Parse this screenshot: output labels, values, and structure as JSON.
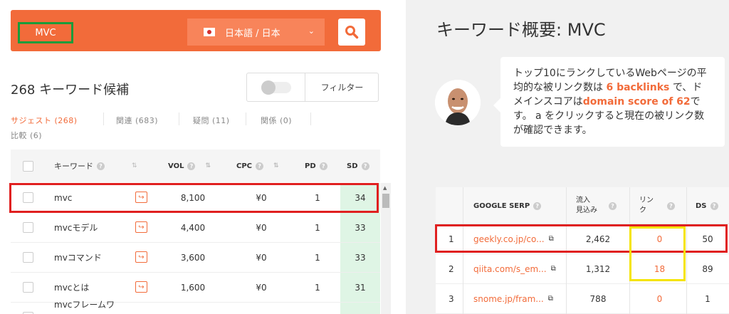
{
  "search": {
    "keyword": "MVC",
    "language": "日本語 / 日本"
  },
  "left": {
    "candidates_label": "268 キーワード候補",
    "filter_label": "フィルター",
    "tabs": [
      {
        "label": "サジェスト (268)",
        "active": true
      },
      {
        "label": "関連 (683)",
        "active": false
      },
      {
        "label": "疑問 (11)",
        "active": false
      },
      {
        "label": "関係 (0)",
        "active": false
      },
      {
        "label": "比較 (6)",
        "active": false
      }
    ],
    "table": {
      "headers": {
        "keyword": "キーワード",
        "vol": "VOL",
        "cpc": "CPC",
        "pd": "PD",
        "sd": "SD"
      },
      "rows": [
        {
          "keyword": "mvc",
          "vol": "8,100",
          "cpc": "¥0",
          "pd": "1",
          "sd": "34"
        },
        {
          "keyword": "mvcモデル",
          "vol": "4,400",
          "cpc": "¥0",
          "pd": "1",
          "sd": "33"
        },
        {
          "keyword": "mvコマンド",
          "vol": "3,600",
          "cpc": "¥0",
          "pd": "1",
          "sd": "33"
        },
        {
          "keyword": "mvcとは",
          "vol": "1,600",
          "cpc": "¥0",
          "pd": "1",
          "sd": "31"
        },
        {
          "keyword": "mvcフレームワ",
          "vol": "",
          "cpc": "",
          "pd": "",
          "sd": ""
        }
      ]
    }
  },
  "right": {
    "title_prefix": "キーワード概要:",
    "title_keyword": "MVC",
    "bubble": {
      "t1": "トップ10にランクしているWebページの平均的な被リンク数は",
      "h1": "6 backlinks",
      "t2": "で、ドメインスコアは",
      "h2": "domain score of 62",
      "t3": "です。 a をクリックすると現在の被リンク数が確認できます。"
    },
    "serp": {
      "headers": {
        "serp": "GOOGLE SERP",
        "traffic_1": "流入",
        "traffic_2": "見込み",
        "links_1": "リン",
        "links_2": "ク",
        "ds": "DS"
      },
      "rows": [
        {
          "rank": "1",
          "url": "geekly.co.jp/co...",
          "traffic": "2,462",
          "links": "0",
          "ds": "50"
        },
        {
          "rank": "2",
          "url": "qiita.com/s_em...",
          "traffic": "1,312",
          "links": "18",
          "ds": "89"
        },
        {
          "rank": "3",
          "url": "snome.jp/fram...",
          "traffic": "788",
          "links": "0",
          "ds": "1"
        }
      ]
    }
  },
  "colors": {
    "accent": "#f26b3a",
    "highlight_red": "#e02020",
    "highlight_green": "#1a9c3b",
    "highlight_yellow": "#f5e400",
    "sd_green": "#dff5e5"
  },
  "icons": {
    "search": "search-icon",
    "flag": "japan-flag-icon",
    "redirect": "redirect-arrow-icon",
    "external": "external-link-icon",
    "help": "help-icon"
  }
}
